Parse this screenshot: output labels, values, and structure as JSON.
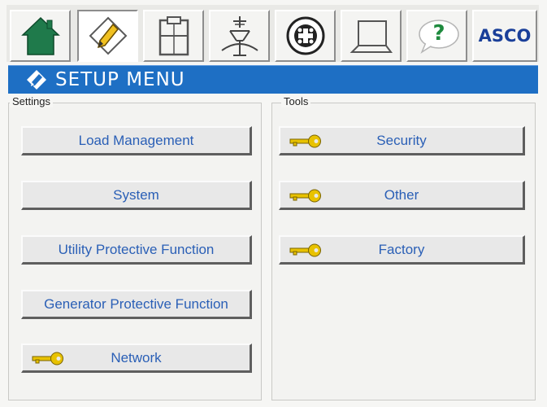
{
  "toolbar": {
    "tabs": [
      {
        "name": "home",
        "icon": "home-icon"
      },
      {
        "name": "setup",
        "icon": "pencil-icon",
        "active": true
      },
      {
        "name": "clipboard",
        "icon": "clipboard-icon"
      },
      {
        "name": "switch",
        "icon": "transfer-switch-icon"
      },
      {
        "name": "diagnostics",
        "icon": "circuit-icon"
      },
      {
        "name": "laptop",
        "icon": "laptop-icon"
      },
      {
        "name": "help",
        "icon": "help-icon",
        "label": "?"
      },
      {
        "name": "brand",
        "icon": "asco-logo",
        "label": "ASCO"
      }
    ],
    "help_label": "?",
    "brand_label": "ASCO"
  },
  "title": {
    "text": "SETUP MENU",
    "icon": "pencil-icon",
    "color": "#1e6fc4"
  },
  "settings": {
    "label": "Settings",
    "buttons": [
      {
        "label": "Load Management"
      },
      {
        "label": "System"
      },
      {
        "label": "Utility Protective Function"
      },
      {
        "label": "Generator Protective Function"
      },
      {
        "label": "Network",
        "icon": "key-icon"
      }
    ]
  },
  "tools": {
    "label": "Tools",
    "buttons": [
      {
        "label": "Security",
        "icon": "key-icon"
      },
      {
        "label": "Other",
        "icon": "key-icon"
      },
      {
        "label": "Factory",
        "icon": "key-icon"
      }
    ]
  },
  "colors": {
    "title_bar": "#1e6fc4",
    "button_text": "#2a5fb6",
    "key_icon": "#e8c200",
    "home_icon": "#1e7a4a"
  }
}
